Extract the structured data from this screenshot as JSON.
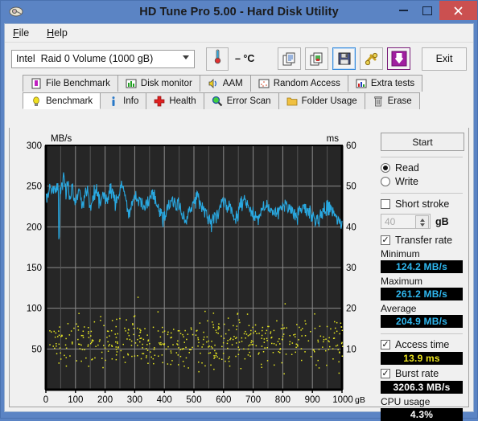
{
  "window": {
    "title": "HD Tune Pro 5.00 - Hard Disk Utility",
    "icon": "hard-disk-icon",
    "minimize": "–",
    "maximize": "□",
    "close": "✕"
  },
  "menu": {
    "items": [
      "File",
      "Help"
    ]
  },
  "toolbar": {
    "drive_vendor": "Intel",
    "drive_name": "Raid 0 Volume (1000 gB)",
    "temperature": "– °C",
    "thermometer_icon": "thermometer-icon",
    "buttons": [
      {
        "name": "copy-text-icon",
        "label": ""
      },
      {
        "name": "copy-image-icon",
        "label": ""
      },
      {
        "name": "save-icon",
        "label": ""
      },
      {
        "name": "tools-icon",
        "label": ""
      },
      {
        "name": "download-icon",
        "label": ""
      }
    ],
    "exit_label": "Exit"
  },
  "tabs": {
    "row1": [
      {
        "label": "File Benchmark",
        "icon": "file-benchmark-icon",
        "active": false
      },
      {
        "label": "Disk monitor",
        "icon": "disk-monitor-icon",
        "active": false
      },
      {
        "label": "AAM",
        "icon": "speaker-icon",
        "active": false
      },
      {
        "label": "Random Access",
        "icon": "random-access-icon",
        "active": false
      },
      {
        "label": "Extra tests",
        "icon": "extra-tests-icon",
        "active": false
      }
    ],
    "row2": [
      {
        "label": "Benchmark",
        "icon": "bulb-icon",
        "active": true
      },
      {
        "label": "Info",
        "icon": "info-icon",
        "active": false
      },
      {
        "label": "Health",
        "icon": "health-cross-icon",
        "active": false
      },
      {
        "label": "Error Scan",
        "icon": "magnifier-icon",
        "active": false
      },
      {
        "label": "Folder Usage",
        "icon": "folder-icon",
        "active": false
      },
      {
        "label": "Erase",
        "icon": "trash-icon",
        "active": false
      }
    ]
  },
  "sidebar": {
    "start_label": "Start",
    "mode": {
      "read_label": "Read",
      "write_label": "Write",
      "selected": "Read"
    },
    "short_stroke": {
      "label": "Short stroke",
      "checked": false,
      "value": "40",
      "unit": "gB"
    },
    "transfer_rate": {
      "label": "Transfer rate",
      "checked": true
    },
    "minimum": {
      "label": "Minimum",
      "value": "124.2 MB/s"
    },
    "maximum": {
      "label": "Maximum",
      "value": "261.2 MB/s"
    },
    "average": {
      "label": "Average",
      "value": "204.9 MB/s"
    },
    "access_time": {
      "label": "Access time",
      "checked": true,
      "value": "13.9 ms"
    },
    "burst_rate": {
      "label": "Burst rate",
      "checked": true,
      "value": "3206.3 MB/s"
    },
    "cpu_usage": {
      "label": "CPU usage",
      "value": "4.3%"
    }
  },
  "chart_data": {
    "type": "line",
    "title": "",
    "xlabel": "gB",
    "ylabel": "MB/s",
    "y2label": "ms",
    "xlim": [
      0,
      1000
    ],
    "ylim": [
      0,
      300
    ],
    "y2lim": [
      0,
      60
    ],
    "grid": true,
    "legend": "none",
    "background": "#262626",
    "x_ticks": [
      0,
      100,
      200,
      300,
      400,
      500,
      600,
      700,
      800,
      900,
      1000
    ],
    "y_ticks": [
      50,
      100,
      150,
      200,
      250,
      300
    ],
    "y2_ticks": [
      10,
      20,
      30,
      40,
      50,
      60
    ],
    "series": [
      {
        "name": "Transfer rate",
        "type": "line",
        "color": "#29a8e0",
        "axis": "left",
        "x": [
          0,
          5,
          10,
          14,
          18,
          22,
          25,
          28,
          31,
          34,
          37,
          40,
          42,
          44,
          46,
          48,
          50,
          52,
          54,
          56,
          58,
          60,
          63,
          66,
          69,
          72,
          75,
          78,
          81,
          84,
          87,
          90,
          93,
          96,
          99,
          102,
          105,
          108,
          111,
          114,
          117,
          120,
          124,
          128,
          132,
          136,
          140,
          144,
          148,
          152,
          156,
          160,
          164,
          168,
          172,
          176,
          180,
          184,
          188,
          192,
          196,
          200,
          205,
          210,
          215,
          220,
          225,
          230,
          235,
          240,
          245,
          250,
          255,
          260,
          265,
          270,
          275,
          280,
          285,
          290,
          295,
          300,
          306,
          312,
          318,
          324,
          330,
          336,
          342,
          348,
          354,
          360,
          366,
          372,
          378,
          384,
          390,
          396,
          402,
          408,
          414,
          420,
          427,
          434,
          441,
          448,
          455,
          462,
          469,
          476,
          483,
          490,
          497,
          504,
          511,
          518,
          525,
          532,
          539,
          546,
          553,
          560,
          568,
          576,
          584,
          592,
          600,
          608,
          616,
          624,
          632,
          640,
          648,
          656,
          664,
          672,
          680,
          688,
          696,
          704,
          712,
          720,
          729,
          738,
          747,
          756,
          765,
          774,
          783,
          792,
          801,
          810,
          819,
          828,
          837,
          846,
          855,
          864,
          873,
          882,
          891,
          900,
          910,
          920,
          930,
          940,
          950,
          960,
          970,
          980,
          990,
          1000
        ],
        "y": [
          238,
          236,
          241,
          245,
          243,
          239,
          248,
          246,
          244,
          241,
          249,
          250,
          247,
          175,
          196,
          243,
          248,
          252,
          247,
          250,
          255,
          261,
          252,
          247,
          244,
          248,
          246,
          243,
          240,
          238,
          242,
          245,
          239,
          234,
          230,
          233,
          237,
          241,
          246,
          243,
          239,
          232,
          228,
          234,
          240,
          244,
          241,
          236,
          230,
          227,
          234,
          238,
          243,
          247,
          244,
          238,
          233,
          229,
          235,
          240,
          244,
          239,
          233,
          236,
          241,
          245,
          242,
          237,
          231,
          234,
          239,
          243,
          250,
          247,
          241,
          235,
          228,
          215,
          219,
          226,
          231,
          235,
          238,
          236,
          232,
          228,
          224,
          221,
          226,
          232,
          238,
          241,
          237,
          231,
          225,
          219,
          214,
          210,
          216,
          222,
          228,
          233,
          237,
          234,
          229,
          224,
          219,
          212,
          206,
          210,
          216,
          222,
          227,
          231,
          234,
          230,
          226,
          222,
          217,
          212,
          207,
          203,
          210,
          216,
          221,
          226,
          230,
          227,
          223,
          219,
          215,
          212,
          218,
          223,
          227,
          230,
          226,
          222,
          218,
          214,
          210,
          216,
          221,
          225,
          229,
          226,
          222,
          218,
          214,
          220,
          225,
          228,
          224,
          220,
          216,
          212,
          218,
          223,
          226,
          222,
          218,
          214,
          210,
          206,
          214,
          220,
          224,
          220,
          216,
          212,
          208,
          204,
          212,
          218,
          222,
          218,
          214,
          210,
          206,
          213,
          218,
          214,
          210,
          206,
          212,
          208
        ]
      },
      {
        "name": "Access time",
        "type": "scatter",
        "color": "#e8e822",
        "axis": "right",
        "point_count": 500,
        "y_range_ms": [
          3,
          25
        ],
        "y_typical_ms": [
          8,
          16
        ],
        "note": "yellow dots scattered across full x range, densest between 8 and 16 ms"
      }
    ]
  }
}
